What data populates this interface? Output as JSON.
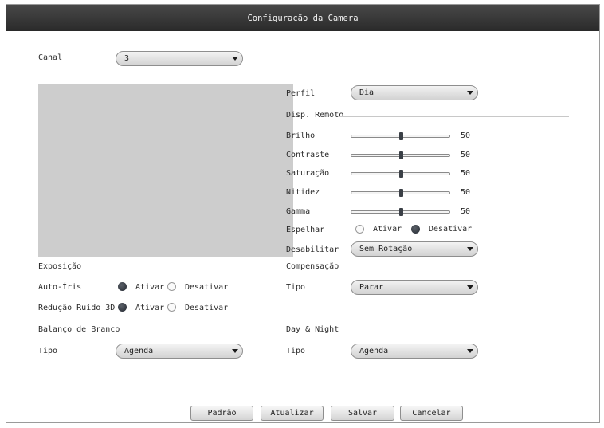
{
  "window": {
    "title": "Configuração da Camera"
  },
  "canal": {
    "label": "Canal",
    "value": "3"
  },
  "perfil": {
    "label": "Perfil",
    "value": "Dia"
  },
  "disp_remoto": {
    "section": "Disp. Remoto",
    "sliders": [
      {
        "label": "Brilho",
        "value": "50",
        "fraction": 0.5
      },
      {
        "label": "Contraste",
        "value": "50",
        "fraction": 0.5
      },
      {
        "label": "Saturação",
        "value": "50",
        "fraction": 0.5
      },
      {
        "label": "Nitidez",
        "value": "50",
        "fraction": 0.5
      },
      {
        "label": "Gamma",
        "value": "50",
        "fraction": 0.5
      }
    ],
    "espelhar": {
      "label": "Espelhar",
      "option_on": "Ativar",
      "option_off": "Desativar",
      "selected": "Desativar"
    },
    "desabilitar": {
      "label": "Desabilitar",
      "value": "Sem Rotação"
    }
  },
  "exposicao": {
    "section": "Exposição",
    "auto_iris": {
      "label": "Auto-Íris",
      "option_on": "Ativar",
      "option_off": "Desativar",
      "selected": "Ativar"
    },
    "reducao_ruido": {
      "label": "Redução Ruído 3D",
      "option_on": "Ativar",
      "option_off": "Desativar",
      "selected": "Ativar"
    }
  },
  "compensacao": {
    "section": "Compensação",
    "tipo_label": "Tipo",
    "tipo_value": "Parar"
  },
  "balanco": {
    "section": "Balanço de Branco",
    "tipo_label": "Tipo",
    "tipo_value": "Agenda"
  },
  "day_night": {
    "section": "Day & Night",
    "tipo_label": "Tipo",
    "tipo_value": "Agenda"
  },
  "buttons": {
    "padrao": "Padrão",
    "atualizar": "Atualizar",
    "salvar": "Salvar",
    "cancelar": "Cancelar"
  },
  "colors": {
    "titlebar": "#333333",
    "preview": "#cdcdcd",
    "radio_selected": "#2b3038"
  }
}
